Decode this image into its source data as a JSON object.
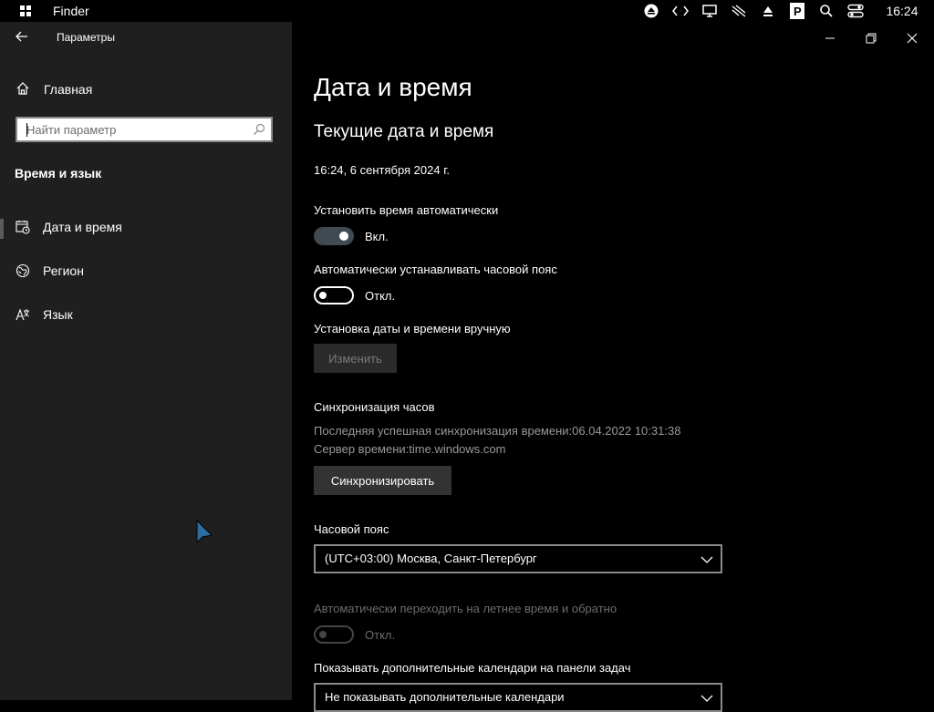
{
  "topbar": {
    "app_name": "Finder",
    "clock": "16:24",
    "tray_icons": [
      "eject-icon",
      "code-icon",
      "display-icon",
      "mute-icon",
      "upload-icon",
      "parking-icon",
      "search-icon",
      "control-center-icon"
    ]
  },
  "window": {
    "title": "Параметры"
  },
  "sidebar": {
    "home_label": "Главная",
    "search_placeholder": "Найти параметр",
    "section_title": "Время и язык",
    "items": [
      {
        "label": "Дата и время",
        "icon": "calendar-clock-icon",
        "selected": true
      },
      {
        "label": "Регион",
        "icon": "globe-icon",
        "selected": false
      },
      {
        "label": "Язык",
        "icon": "language-icon",
        "selected": false
      }
    ]
  },
  "main": {
    "page_title": "Дата и время",
    "subtitle": "Текущие дата и время",
    "current_datetime": "16:24, 6 сентября 2024 г.",
    "auto_time": {
      "label": "Установить время автоматически",
      "state": "Вкл.",
      "on": true
    },
    "auto_timezone": {
      "label": "Автоматически устанавливать часовой пояс",
      "state": "Откл.",
      "on": false
    },
    "manual": {
      "label": "Установка даты и времени вручную",
      "button": "Изменить"
    },
    "sync": {
      "label": "Синхронизация часов",
      "last_sync": "Последняя успешная синхронизация времени:06.04.2022 10:31:38",
      "server": "Сервер времени:time.windows.com",
      "button": "Синхронизировать"
    },
    "timezone": {
      "label": "Часовой пояс",
      "value": "(UTC+03:00) Москва, Санкт-Петербург"
    },
    "dst": {
      "label": "Автоматически переходить на летнее время и обратно",
      "state": "Откл.",
      "on": false,
      "disabled": true
    },
    "calendars": {
      "label": "Показывать дополнительные календари на панели задач",
      "value": "Не показывать дополнительные календари"
    }
  }
}
